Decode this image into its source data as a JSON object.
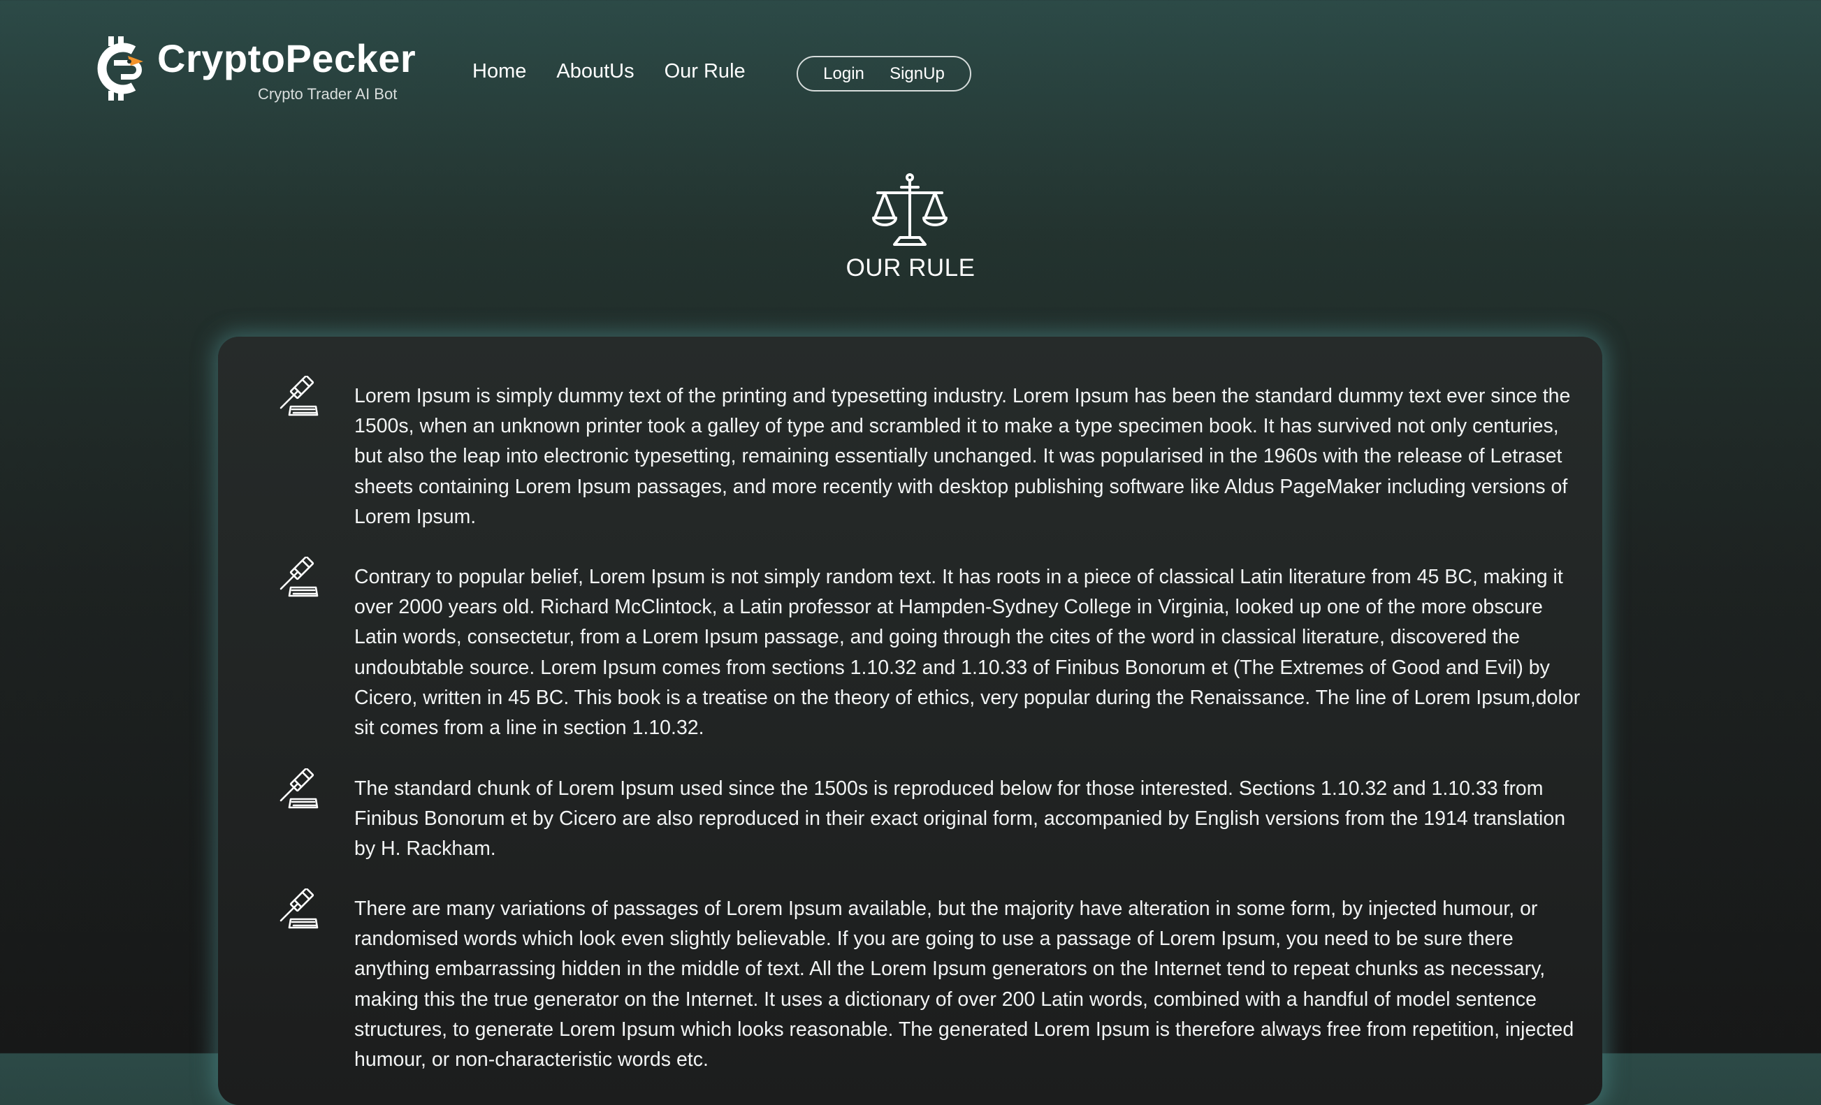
{
  "brand": {
    "name": "CryptoPecker",
    "tagline": "Crypto Trader AI Bot",
    "accent_color": "#f2922a"
  },
  "nav": {
    "links": [
      "Home",
      "AboutUs",
      "Our Rule"
    ],
    "login_label": "Login",
    "signup_label": "SignUp"
  },
  "hero": {
    "icon": "balance-scale-icon",
    "title": "OUR RULE"
  },
  "rules": [
    {
      "icon": "gavel-icon",
      "text": "Lorem Ipsum is simply dummy text of the printing and typesetting industry. Lorem Ipsum has been the standard dummy text ever since the 1500s, when an unknown printer took a galley of type and scrambled it to make a type specimen book. It has survived not only centuries, but also the leap into electronic typesetting, remaining essentially unchanged. It was popularised in the 1960s with the release of Letraset sheets containing Lorem Ipsum passages, and more recently with desktop publishing software like Aldus PageMaker including versions of Lorem Ipsum."
    },
    {
      "icon": "gavel-icon",
      "text": "Contrary to popular belief, Lorem Ipsum is not simply random text. It has roots in a piece of classical Latin literature from 45 BC, making it over 2000 years old. Richard McClintock, a Latin professor at Hampden-Sydney College in Virginia, looked up one of the more obscure Latin words, consectetur, from a Lorem Ipsum passage, and going through the cites of the word in classical literature, discovered the undoubtable source. Lorem Ipsum comes from sections 1.10.32 and 1.10.33 of Finibus Bonorum et (The Extremes of Good and Evil) by Cicero, written in 45 BC. This book is a treatise on the theory of ethics, very popular during the Renaissance. The line of Lorem Ipsum,dolor sit comes from a line in section 1.10.32."
    },
    {
      "icon": "gavel-icon",
      "text": "The standard chunk of Lorem Ipsum used since the 1500s is reproduced below for those interested. Sections 1.10.32 and 1.10.33 from Finibus Bonorum et by Cicero are also reproduced in their exact original form, accompanied by English versions from the 1914 translation by H. Rackham."
    },
    {
      "icon": "gavel-icon",
      "text": "There are many variations of passages of Lorem Ipsum available, but the majority have alteration in some form, by injected humour, or randomised words which look even slightly believable. If you are going to use a passage of Lorem Ipsum, you need to be sure there anything embarrassing hidden in the middle of text. All the Lorem Ipsum generators on the Internet tend to repeat chunks as necessary, making this the true generator on the Internet. It uses a dictionary of over 200 Latin words, combined with a handful of model sentence structures, to generate Lorem Ipsum which looks reasonable. The generated Lorem Ipsum is therefore always free from repetition, injected humour, or non-characteristic words etc."
    }
  ]
}
